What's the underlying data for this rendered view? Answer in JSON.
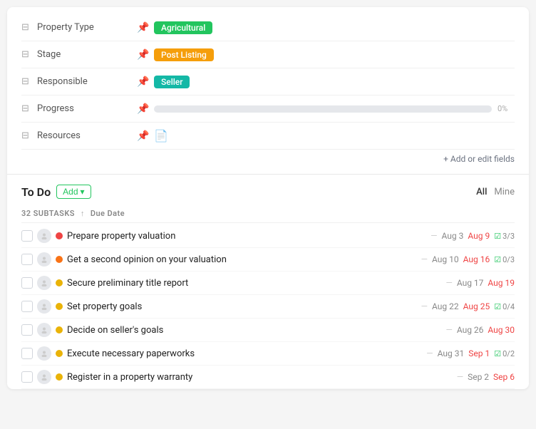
{
  "properties": {
    "rows": [
      {
        "id": "property-type",
        "icon": "⊟",
        "label": "Property Type",
        "value_type": "badge",
        "badge_text": "Agricultural",
        "badge_color": "green"
      },
      {
        "id": "stage",
        "icon": "⊟",
        "label": "Stage",
        "value_type": "badge",
        "badge_text": "Post Listing",
        "badge_color": "yellow"
      },
      {
        "id": "responsible",
        "icon": "⊟",
        "label": "Responsible",
        "value_type": "badge",
        "badge_text": "Seller",
        "badge_color": "teal"
      },
      {
        "id": "progress",
        "icon": "⊟",
        "label": "Progress",
        "value_type": "progress",
        "progress_pct": 0,
        "progress_label": "0%"
      },
      {
        "id": "resources",
        "icon": "⊟",
        "label": "Resources",
        "value_type": "resource"
      }
    ],
    "add_edit_label": "+ Add or edit fields"
  },
  "todo": {
    "title": "To Do",
    "add_button_label": "Add",
    "filter_all": "All",
    "filter_mine": "Mine",
    "subtasks_count": "32 SUBTASKS",
    "sort_label": "Due Date",
    "tasks": [
      {
        "name": "Prepare property valuation",
        "status_color": "red",
        "date1": "Aug 3",
        "date2": "Aug 9",
        "date2_overdue": true,
        "subtask": "3/3",
        "subtask_checked": true
      },
      {
        "name": "Get a second opinion on your valuation",
        "status_color": "orange",
        "date1": "Aug 10",
        "date2": "Aug 16",
        "date2_overdue": true,
        "subtask": "0/3",
        "subtask_checked": true
      },
      {
        "name": "Secure preliminary title report",
        "status_color": "yellow",
        "date1": "Aug 17",
        "date2": "Aug 19",
        "date2_overdue": true,
        "subtask": "",
        "subtask_checked": false
      },
      {
        "name": "Set property goals",
        "status_color": "yellow",
        "date1": "Aug 22",
        "date2": "Aug 25",
        "date2_overdue": true,
        "subtask": "0/4",
        "subtask_checked": true
      },
      {
        "name": "Decide on seller's goals",
        "status_color": "yellow",
        "date1": "Aug 26",
        "date2": "Aug 30",
        "date2_overdue": true,
        "subtask": "",
        "subtask_checked": false
      },
      {
        "name": "Execute necessary paperworks",
        "status_color": "yellow",
        "date1": "Aug 31",
        "date2": "Sep 1",
        "date2_overdue": true,
        "subtask": "0/2",
        "subtask_checked": true
      },
      {
        "name": "Register in a property warranty",
        "status_color": "yellow",
        "date1": "Sep 2",
        "date2": "Sep 6",
        "date2_overdue": true,
        "subtask": "",
        "subtask_checked": false
      }
    ]
  }
}
